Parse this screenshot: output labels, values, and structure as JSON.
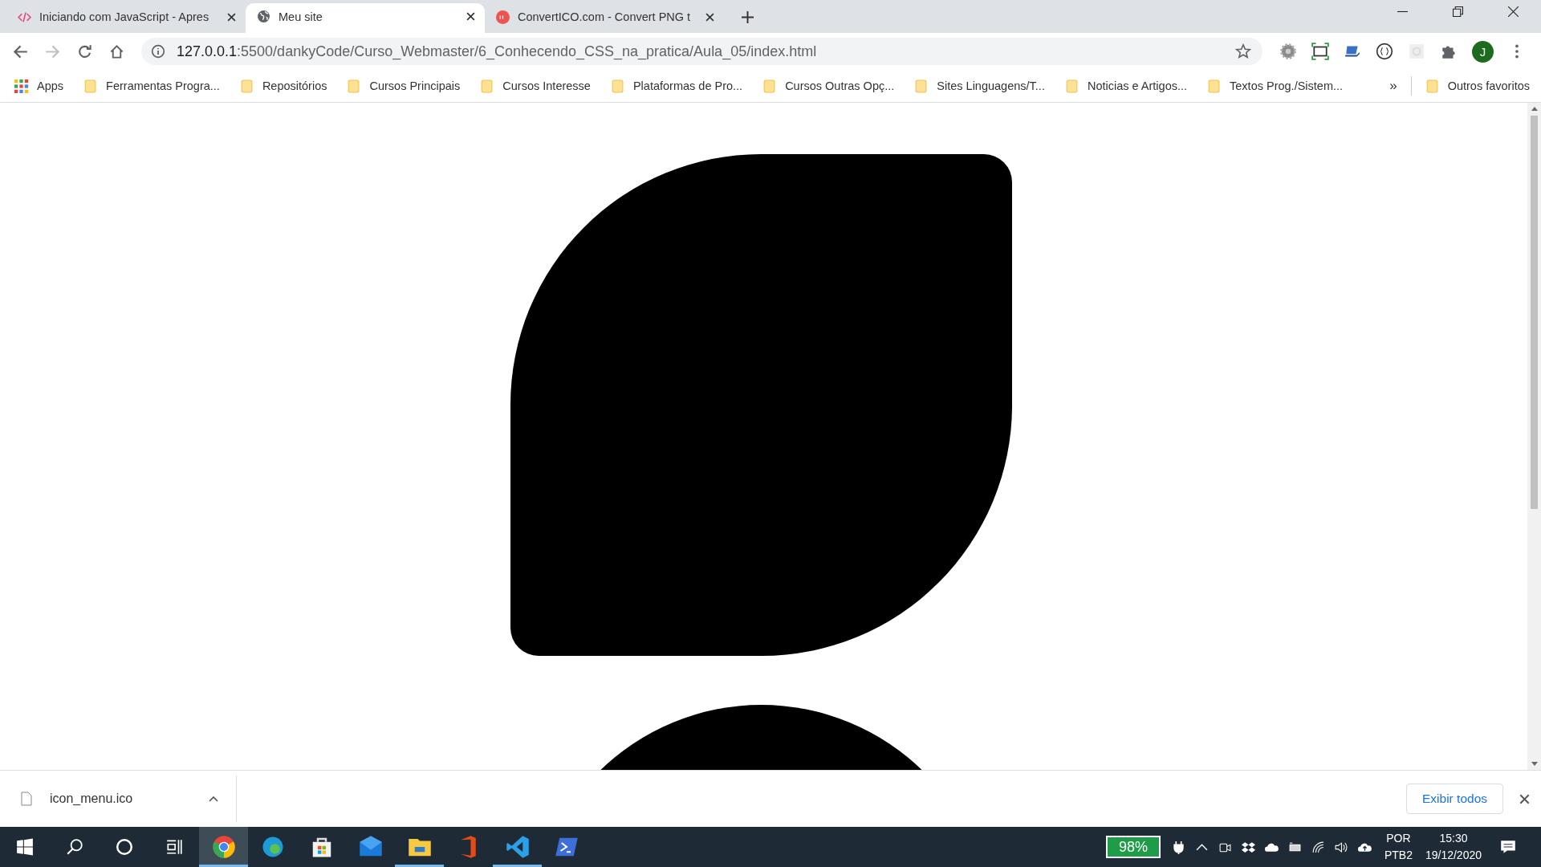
{
  "tabs": [
    {
      "title": "Iniciando com JavaScript - Apres",
      "kind": "code",
      "selected": false
    },
    {
      "title": "Meu site",
      "kind": "globe",
      "selected": true
    },
    {
      "title": "ConvertICO.com - Convert PNG t",
      "kind": "ci",
      "selected": false
    }
  ],
  "address": {
    "host": "127.0.0.1",
    "path": ":5500/dankyCode/Curso_Webmaster/6_Conhecendo_CSS_na_pratica/Aula_05/index.html"
  },
  "profile_initial": "J",
  "bookmarks": [
    {
      "label": "Apps",
      "kind": "apps"
    },
    {
      "label": "Ferramentas Progra...",
      "kind": "folder"
    },
    {
      "label": "Repositórios",
      "kind": "folder"
    },
    {
      "label": "Cursos Principais",
      "kind": "folder"
    },
    {
      "label": "Cursos Interesse",
      "kind": "folder"
    },
    {
      "label": "Plataformas de Pro...",
      "kind": "folder"
    },
    {
      "label": "Cursos Outras Opç...",
      "kind": "folder"
    },
    {
      "label": "Sites Linguagens/T...",
      "kind": "folder"
    },
    {
      "label": "Noticias e Artigos...",
      "kind": "folder"
    },
    {
      "label": "Textos Prog./Sistem...",
      "kind": "folder"
    }
  ],
  "bookmarks_more": "»",
  "other_bookmarks": "Outros favoritos",
  "download": {
    "file": "icon_menu.ico",
    "show_all": "Exibir todos"
  },
  "taskbar": [
    {
      "kind": "chrome",
      "selected": true,
      "running": true
    },
    {
      "kind": "edge",
      "selected": false,
      "running": false
    },
    {
      "kind": "store",
      "selected": false,
      "running": false
    },
    {
      "kind": "mail",
      "selected": false,
      "running": false
    },
    {
      "kind": "explorer",
      "selected": false,
      "running": true
    },
    {
      "kind": "office",
      "selected": false,
      "running": false
    },
    {
      "kind": "vscode",
      "selected": false,
      "running": true
    },
    {
      "kind": "terminal",
      "selected": false,
      "running": false
    }
  ],
  "tray": {
    "battery": "98%",
    "lang": "POR",
    "layout": "PTB2",
    "time": "15:30",
    "date": "19/12/2020"
  }
}
